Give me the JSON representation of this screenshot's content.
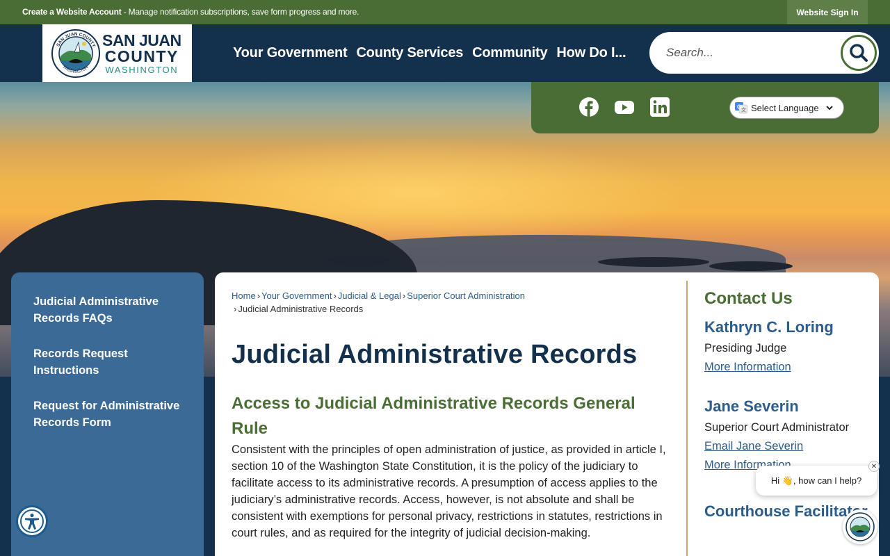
{
  "topbar": {
    "create_account": "Create a Website Account",
    "description": " - Manage notification subscriptions, save form progress and more.",
    "sign_in": "Website Sign In"
  },
  "logo": {
    "line1": "SAN JUAN",
    "line2": "COUNTY",
    "line3": "WASHINGTON",
    "seal_top": "SAN JUAN COUNTY",
    "seal_bottom": "WASHINGTON"
  },
  "nav": {
    "items": [
      "Your Government",
      "County Services",
      "Community",
      "How Do I..."
    ]
  },
  "search": {
    "placeholder": "Search..."
  },
  "social": {
    "icons": [
      "facebook-icon",
      "youtube-icon",
      "linkedin-icon"
    ],
    "language_label": "Select Language"
  },
  "sidebar": {
    "items": [
      "Judicial Administrative Records FAQs",
      "Records Request Instructions",
      "Request for Administrative Records Form"
    ]
  },
  "breadcrumb": {
    "items": [
      "Home",
      "Your Government",
      "Judicial & Legal",
      "Superior Court Administration"
    ],
    "current": "Judicial Administrative Records"
  },
  "main": {
    "title": "Judicial Administrative Records",
    "subtitle": "Access to Judicial Administrative Records General Rule",
    "paragraph": "Consistent with the principles of open administration of justice, as provided in article I, section 10 of the Washington State Constitution, it is the policy of the judiciary to facilitate access to its administrative records. A presumption of access applies to the judiciary’s administrative records. Access, however, is not absolute and shall be consistent with exemptions for personal privacy, restrictions in statutes, restrictions in court rules, and as required for the integrity of judicial decision-making."
  },
  "contact": {
    "heading": "Contact Us",
    "people": [
      {
        "name": "Kathryn C. Loring",
        "role": "Presiding Judge",
        "links": [
          "More Information"
        ]
      },
      {
        "name": "Jane Severin",
        "role": "Superior Court Administrator",
        "links": [
          "Email Jane Severin",
          "More Information"
        ]
      },
      {
        "name": "Courthouse Facilitator"
      }
    ]
  },
  "chat": {
    "greeting": "Hi 👋, how can I help?",
    "close": "✕"
  },
  "colors": {
    "navy": "#13304d",
    "green": "#4a6d35",
    "sidebar_blue": "#3b6a96",
    "link_blue": "#2b5c8a",
    "divider_tan": "#c9a46e"
  }
}
